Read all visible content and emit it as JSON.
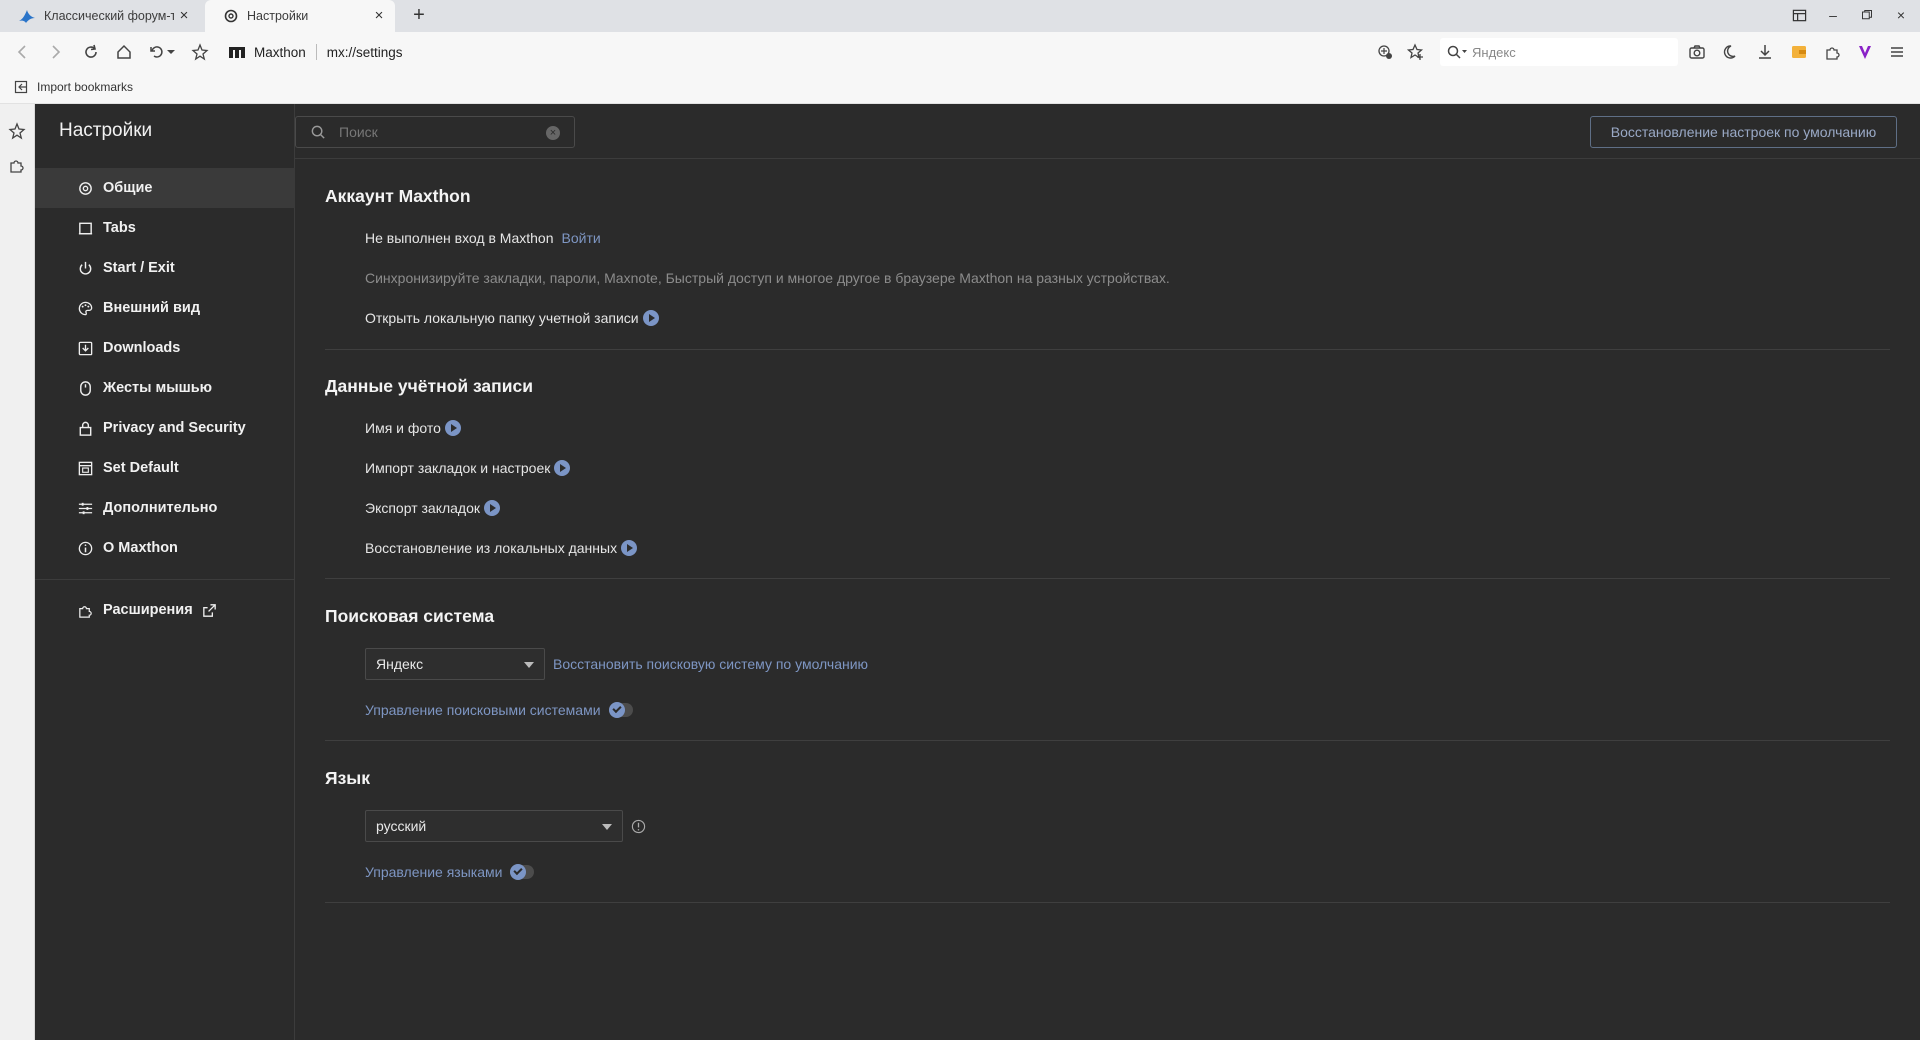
{
  "tabs": [
    {
      "title": "Классический форум-т",
      "icon": "maxthon-bird-icon"
    },
    {
      "title": "Настройки",
      "icon": "gear-icon"
    }
  ],
  "toolbar": {
    "brand": "Maxthon",
    "url": "mx://settings",
    "search_placeholder": "Яндекс"
  },
  "bookmarks_bar": {
    "import_label": "Import bookmarks"
  },
  "settings": {
    "title": "Настройки",
    "search_placeholder": "Поиск",
    "reset_label": "Восстановление настроек по умолчанию"
  },
  "nav": {
    "items": [
      {
        "label": "Общие",
        "icon": "gear-icon",
        "active": true
      },
      {
        "label": "Tabs",
        "icon": "tabs-icon"
      },
      {
        "label": "Start / Exit",
        "icon": "power-icon"
      },
      {
        "label": "Внешний вид",
        "icon": "palette-icon"
      },
      {
        "label": "Downloads",
        "icon": "download-icon"
      },
      {
        "label": "Жесты мышью",
        "icon": "mouse-icon"
      },
      {
        "label": "Privacy and Security",
        "icon": "lock-icon"
      },
      {
        "label": "Set Default",
        "icon": "browser-default-icon"
      },
      {
        "label": "Дополнительно",
        "icon": "sliders-icon"
      },
      {
        "label": "О Maxthon",
        "icon": "info-icon"
      }
    ],
    "extensions_label": "Расширения"
  },
  "account": {
    "title": "Аккаунт Maxthon",
    "status": "Не выполнен вход в Maxthon",
    "login": "Войти",
    "sync_desc": "Синхронизируйте закладки, пароли, Maxnote, Быстрый доступ и многое другое в браузере Maxthon на разных устройствах.",
    "open_folder": "Открыть локальную папку учетной записи"
  },
  "account_data": {
    "title": "Данные учётной записи",
    "items": [
      "Имя и фото",
      "Импорт закладок и настроек",
      "Экспорт закладок",
      "Восстановление из локальных данных"
    ]
  },
  "search_engine": {
    "title": "Поисковая система",
    "selected": "Яндекс",
    "restore_link": "Восстановить поисковую систему по умолчанию",
    "manage_label": "Управление поисковыми системами"
  },
  "language": {
    "title": "Язык",
    "selected": "русский",
    "manage_label": "Управление языками"
  },
  "colors": {
    "background": "#2b2b2b",
    "accent": "#7b95c6",
    "text": "#e6e6e6"
  }
}
